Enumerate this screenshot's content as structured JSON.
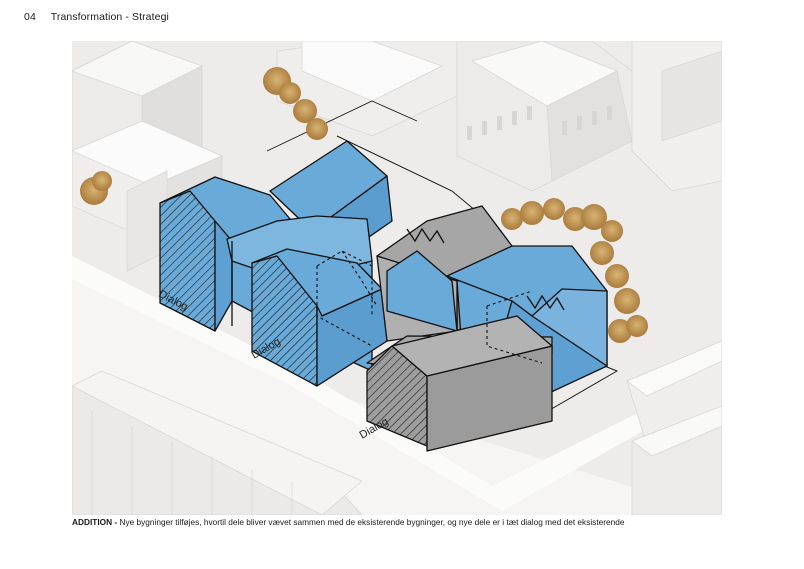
{
  "header": {
    "number": "04",
    "title": "Transformation - Strategi"
  },
  "figure": {
    "labels": [
      "Dialog",
      "Dialog",
      "Dialog"
    ],
    "colors": {
      "new_building": "#6aaad8",
      "existing_building": "#a3a3a3",
      "context": "#f3f2f1",
      "trees": "#c59a55"
    }
  },
  "caption": {
    "lead": "ADDITION -",
    "text": " Nye bygninger tilføjes, hvortil dele bliver vævet sammen med de eksisterende bygninger, og nye dele er i tæt dialog med det eksisterende"
  }
}
